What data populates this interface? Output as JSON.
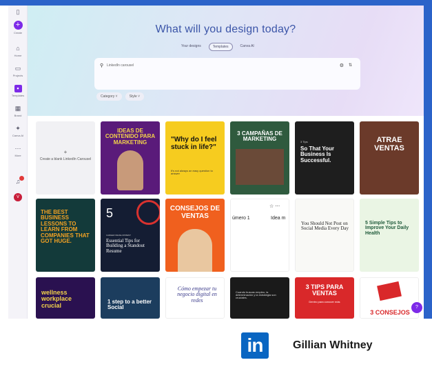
{
  "sidebar": {
    "items": [
      {
        "label": "",
        "icon": "panel-toggle-icon"
      },
      {
        "label": "Create",
        "icon": "plus-icon"
      },
      {
        "label": "Home",
        "icon": "home-icon"
      },
      {
        "label": "Projects",
        "icon": "folder-icon"
      },
      {
        "label": "Templates",
        "icon": "templates-icon"
      },
      {
        "label": "Brand",
        "icon": "brand-icon"
      },
      {
        "label": "Canva AI",
        "icon": "canva-ai-icon"
      },
      {
        "label": "More",
        "icon": "more-icon"
      }
    ],
    "avatar_initial": "V"
  },
  "hero": {
    "title": "What will you design today?",
    "tabs": [
      "Your designs",
      "Templates",
      "Canva AI"
    ],
    "search_value": "LinkedIn carousel",
    "filters": [
      "Category",
      "Style"
    ]
  },
  "blank_card": {
    "plus": "+",
    "label": "Create a blank LinkedIn Carousel"
  },
  "cards": [
    {
      "text": "IDEAS DE CONTENIDO PARA MARKETING"
    },
    {
      "text": "\"Why do I feel stuck in life?\"",
      "sub": "It's not always an easy question to answer"
    },
    {
      "text": "3 CAMPAÑAS DE MARKETING"
    },
    {
      "text": "So That Your Business Is Successful.",
      "sub": "3 Tips"
    },
    {
      "text": "ATRAE VENTAS"
    },
    {
      "text": "THE BEST BUSINESS LESSONS TO LEARN FROM COMPANIES THAT GOT HUGE."
    },
    {
      "text": "Essential Tips for Building a Standout Resume",
      "num": "5",
      "sub": "CAREER DEVELOPMENT"
    },
    {
      "text": "CONSEJOS DE VENTAS"
    },
    {
      "text": "úmero 1",
      "sub": "Idea m"
    },
    {
      "text": "You Should Not Post on Social Media Every Day"
    },
    {
      "text": "5 Simple Tips to Improve Your Daily Health"
    },
    {
      "text": "wellness workplace crucial"
    },
    {
      "text": "1 step to a better Social"
    },
    {
      "text": "Cómo empezar tu negocio digital en redes"
    },
    {
      "text": "Cuando buscas empleo, la determinación y la estrategia son cruciales."
    },
    {
      "text": "3 TIPS PARA VENTAS",
      "sub": "Dentro para conocer más"
    },
    {
      "text": "3 CONSEJOS"
    }
  ],
  "help": "?",
  "footer": {
    "author": "Gillian Whitney",
    "logo_text": "in"
  },
  "colors": {
    "brand_purple": "#7d2ae8",
    "linkedin_blue": "#0a66c2",
    "frame_blue": "#2b63c9"
  }
}
